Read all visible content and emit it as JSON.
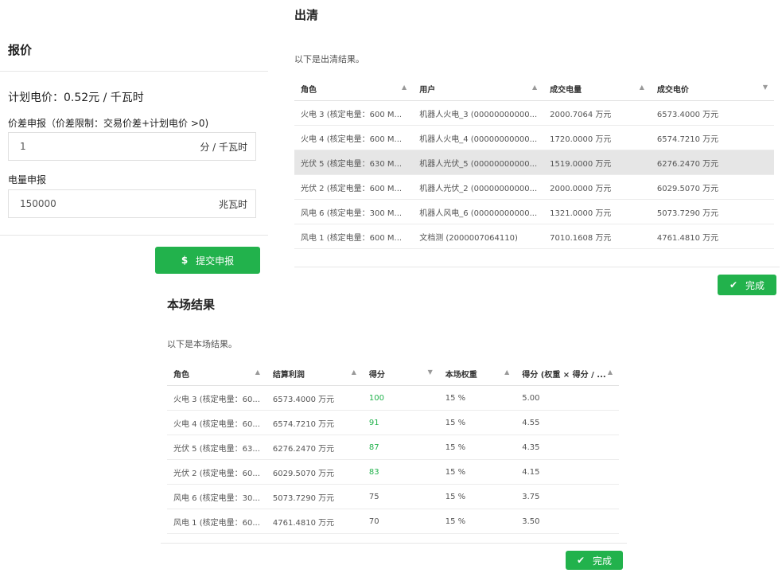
{
  "quote": {
    "title": "报价",
    "plan_price": "计划电价：0.52元 / 千瓦时",
    "price_diff_label": "价差申报（价差限制：交易价差+计划电价 >0)",
    "price_diff_value": "1",
    "price_diff_unit": "分 / 千瓦时",
    "energy_label": "电量申报",
    "energy_value": "150000",
    "energy_unit": "兆瓦时",
    "submit_label": "提交申报"
  },
  "clearing": {
    "title": "出清",
    "hint": "以下是出清结果。",
    "columns": [
      "角色",
      "用户",
      "成交电量",
      "成交电价"
    ],
    "rows": [
      [
        "火电 3 (核定电量：600 M...",
        "机器人火电_3 (00000000000...",
        "2000.7064 万元",
        "6573.4000 万元"
      ],
      [
        "火电 4 (核定电量：600 M...",
        "机器人火电_4 (00000000000...",
        "1720.0000 万元",
        "6574.7210 万元"
      ],
      [
        "光伏 5 (核定电量：630 M...",
        "机器人光伏_5 (00000000000...",
        "1519.0000 万元",
        "6276.2470 万元"
      ],
      [
        "光伏 2 (核定电量：600 M...",
        "机器人光伏_2 (00000000000...",
        "2000.0000 万元",
        "6029.5070 万元"
      ],
      [
        "风电 6 (核定电量：300 M...",
        "机器人风电_6 (00000000000...",
        "1321.0000 万元",
        "5073.7290 万元"
      ],
      [
        "风电 1 (核定电量：600 M...",
        "文档测 (2000007064110)",
        "7010.1608 万元",
        "4761.4810 万元"
      ]
    ],
    "selected_row": 2,
    "confirm_label": "完成"
  },
  "results": {
    "title": "本场结果",
    "hint": "以下是本场结果。",
    "columns": [
      "角色",
      "结算利润",
      "得分",
      "本场权重",
      "得分 (权重 × 得分 / ..."
    ],
    "rows": [
      [
        "火电 3 (核定电量：60...",
        "6573.4000 万元",
        "100",
        "15 %",
        "5.00"
      ],
      [
        "火电 4 (核定电量：60...",
        "6574.7210 万元",
        "91",
        "15 %",
        "4.55"
      ],
      [
        "光伏 5 (核定电量：63...",
        "6276.2470 万元",
        "87",
        "15 %",
        "4.35"
      ],
      [
        "光伏 2 (核定电量：60...",
        "6029.5070 万元",
        "83",
        "15 %",
        "4.15"
      ],
      [
        "风电 6 (核定电量：30...",
        "5073.7290 万元",
        "75",
        "15 %",
        "3.75"
      ],
      [
        "风电 1 (核定电量：60...",
        "4761.4810 万元",
        "70",
        "15 %",
        "3.50"
      ]
    ],
    "confirm_label": "完成"
  },
  "colors": {
    "accent": "#22b24c",
    "selected_row": "#e6e6e6"
  },
  "icons": {
    "submit": "dollar-icon",
    "confirm": "check-icon",
    "sort": "sort-icon"
  }
}
